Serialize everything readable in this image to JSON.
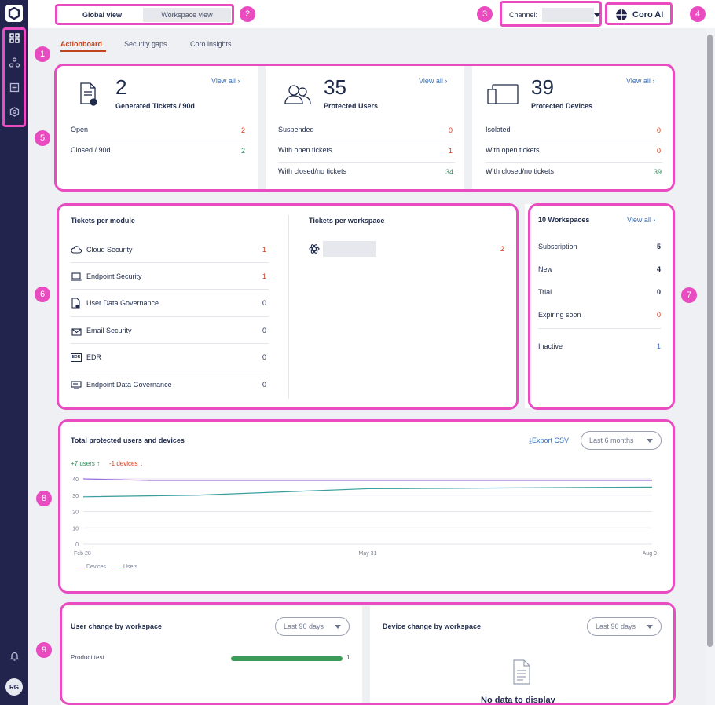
{
  "user": {
    "initials": "RG"
  },
  "top": {
    "global_view": "Global view",
    "workspace_view": "Workspace view",
    "channel_label": "Channel:",
    "coro_ai": "Coro AI"
  },
  "tabs": [
    "Actionboard",
    "Security gaps",
    "Coro insights"
  ],
  "tickets": {
    "count": "2",
    "label": "Generated Tickets / 90d",
    "view_all": "View all",
    "rows": [
      {
        "label": "Open",
        "value": "2"
      },
      {
        "label": "Closed / 90d",
        "value": "2"
      }
    ]
  },
  "users": {
    "count": "35",
    "label": "Protected Users",
    "view_all": "View all",
    "rows": [
      {
        "label": "Suspended",
        "value": "0"
      },
      {
        "label": "With open tickets",
        "value": "1"
      },
      {
        "label": "With closed/no tickets",
        "value": "34"
      }
    ]
  },
  "devices": {
    "count": "39",
    "label": "Protected Devices",
    "view_all": "View all",
    "rows": [
      {
        "label": "Isolated",
        "value": "0"
      },
      {
        "label": "With open tickets",
        "value": "0"
      },
      {
        "label": "With closed/no tickets",
        "value": "39"
      }
    ]
  },
  "modules": {
    "title": "Tickets per module",
    "items": [
      {
        "label": "Cloud Security",
        "value": "1",
        "icon": "cloud-icon"
      },
      {
        "label": "Endpoint Security",
        "value": "1",
        "icon": "laptop-icon"
      },
      {
        "label": "User Data Governance",
        "value": "0",
        "icon": "document-icon"
      },
      {
        "label": "Email Security",
        "value": "0",
        "icon": "mail-icon"
      },
      {
        "label": "EDR",
        "value": "0",
        "icon": "edr-icon"
      },
      {
        "label": "Endpoint Data Governance",
        "value": "0",
        "icon": "monitor-icon"
      }
    ]
  },
  "workspace_tickets": {
    "title": "Tickets per workspace",
    "rows": [
      {
        "value": "2",
        "icon": "workspace-icon"
      }
    ]
  },
  "workspaces": {
    "title": "10 Workspaces",
    "view_all": "View all",
    "rows": [
      {
        "label": "Subscription",
        "value": "5"
      },
      {
        "label": "New",
        "value": "4"
      },
      {
        "label": "Trial",
        "value": "0"
      },
      {
        "label": "Expiring soon",
        "value": "0"
      }
    ],
    "inactive": {
      "label": "Inactive",
      "value": "1"
    }
  },
  "trend": {
    "title": "Total protected users and devices",
    "export": "Export CSV",
    "range": "Last 6 months",
    "users_change": "+7 users",
    "devices_change": "-1 devices"
  },
  "chart_data": {
    "type": "line",
    "x": [
      "Feb 28",
      "May 31",
      "Aug 9"
    ],
    "ylim": [
      0,
      40
    ],
    "yticks": [
      "0",
      "10",
      "20",
      "30",
      "40"
    ],
    "legend": "bottom-left",
    "series": [
      {
        "name": "Devices",
        "color": "#9b6de0",
        "points": [
          [
            0,
            40
          ],
          [
            0.12,
            39
          ],
          [
            0.5,
            39
          ],
          [
            1,
            39
          ]
        ]
      },
      {
        "name": "Users",
        "color": "#3a9e9e",
        "points": [
          [
            0,
            29
          ],
          [
            0.2,
            30
          ],
          [
            0.5,
            34
          ],
          [
            1,
            35
          ]
        ]
      }
    ]
  },
  "user_change": {
    "title": "User change by workspace",
    "range": "Last 90 days",
    "rows": [
      {
        "label": "Product test",
        "value": "1",
        "ratio": 1.0
      }
    ]
  },
  "device_change": {
    "title": "Device change by workspace",
    "range": "Last 90 days",
    "empty": "No data to display"
  },
  "annotations": [
    "1",
    "2",
    "3",
    "4",
    "5",
    "6",
    "7",
    "8",
    "9"
  ]
}
